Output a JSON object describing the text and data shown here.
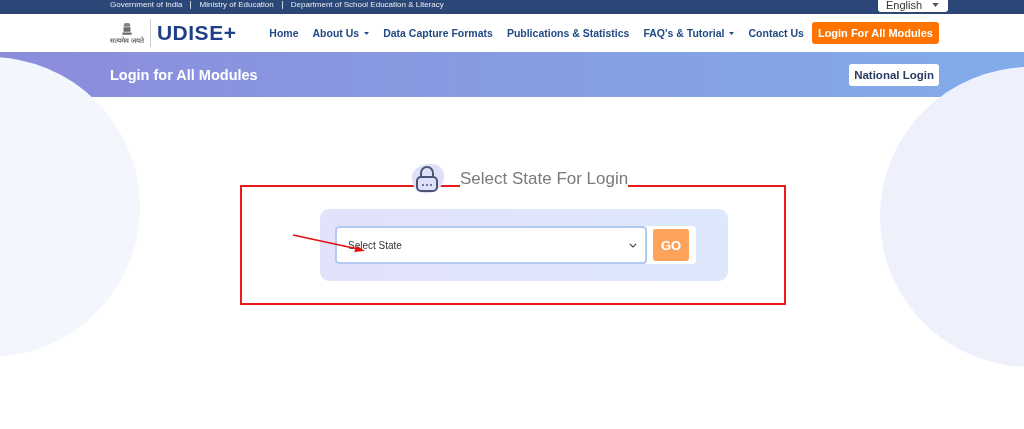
{
  "top_bar": {
    "links": [
      "Government of India",
      "Ministry of Education",
      "Department of School Education & Literacy"
    ],
    "language": "English"
  },
  "header": {
    "emblem_motto": "सत्यमेव जयते",
    "logo": "UDISE+",
    "nav": [
      {
        "label": "Home",
        "kind": "link",
        "dropdown": false
      },
      {
        "label": "About Us",
        "kind": "link",
        "dropdown": true
      },
      {
        "label": "Data Capture Formats",
        "kind": "link",
        "dropdown": false
      },
      {
        "label": "Publications & Statistics",
        "kind": "link",
        "dropdown": false
      },
      {
        "label": "FAQ's & Tutorial",
        "kind": "link",
        "dropdown": true
      },
      {
        "label": "Contact Us",
        "kind": "link",
        "dropdown": false
      },
      {
        "label": "Login For All Modules",
        "kind": "button"
      }
    ]
  },
  "banner": {
    "title": "Login for All Modules",
    "button": "National Login"
  },
  "login": {
    "heading": "Select State For Login",
    "select": {
      "value": "Select State"
    },
    "go_button": "GO"
  }
}
